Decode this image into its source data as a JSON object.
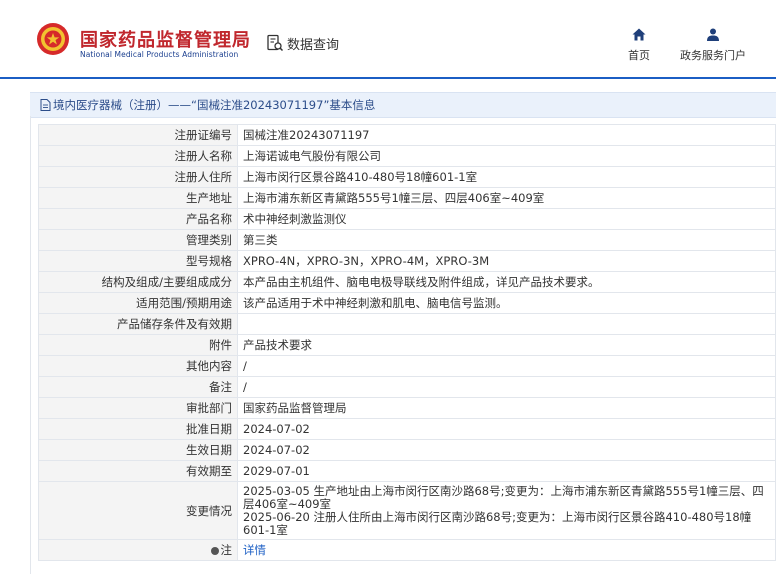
{
  "header": {
    "site_title": "国家药品监督管理局",
    "site_subtitle": "National Medical Products Administration",
    "query_label": "数据查询",
    "nav": [
      {
        "label": "首页",
        "icon": "home-icon"
      },
      {
        "label": "政务服务门户",
        "icon": "user-icon"
      }
    ]
  },
  "breadcrumb": "境内医疗器械（注册）——“国械注准20243071197”基本信息",
  "rows": [
    {
      "label": "注册证编号",
      "value": "国械注准20243071197"
    },
    {
      "label": "注册人名称",
      "value": "上海诺诚电气股份有限公司"
    },
    {
      "label": "注册人住所",
      "value": "上海市闵行区景谷路410-480号18幢601-1室"
    },
    {
      "label": "生产地址",
      "value": "上海市浦东新区青黛路555号1幢三层、四层406室~409室"
    },
    {
      "label": "产品名称",
      "value": "术中神经刺激监测仪"
    },
    {
      "label": "管理类别",
      "value": "第三类"
    },
    {
      "label": "型号规格",
      "value": "XPRO-4N，XPRO-3N，XPRO-4M，XPRO-3M"
    },
    {
      "label": "结构及组成/主要组成成分",
      "value": "本产品由主机组件、脑电电极导联线及附件组成，详见产品技术要求。"
    },
    {
      "label": "适用范围/预期用途",
      "value": "该产品适用于术中神经刺激和肌电、脑电信号监测。"
    },
    {
      "label": "产品储存条件及有效期",
      "value": ""
    },
    {
      "label": "附件",
      "value": "产品技术要求"
    },
    {
      "label": "其他内容",
      "value": "/"
    },
    {
      "label": "备注",
      "value": "/"
    },
    {
      "label": "审批部门",
      "value": "国家药品监督管理局"
    },
    {
      "label": "批准日期",
      "value": "2024-07-02"
    },
    {
      "label": "生效日期",
      "value": "2024-07-02"
    },
    {
      "label": "有效期至",
      "value": "2029-07-01"
    }
  ],
  "change": {
    "label": "变更情况",
    "entries": [
      "2025-03-05 生产地址由上海市闵行区南沙路68号;变更为：上海市浦东新区青黛路555号1幢三层、四层406室~409室",
      "2025-06-20 注册人住所由上海市闵行区南沙路68号;变更为：上海市闵行区景谷路410-480号18幢601-1室"
    ]
  },
  "note": {
    "label": "注",
    "link": "详情"
  },
  "colors": {
    "title_red": "#c0272d",
    "accent_blue": "#1b5ec4",
    "crumb_bg": "#eaf1fb"
  }
}
